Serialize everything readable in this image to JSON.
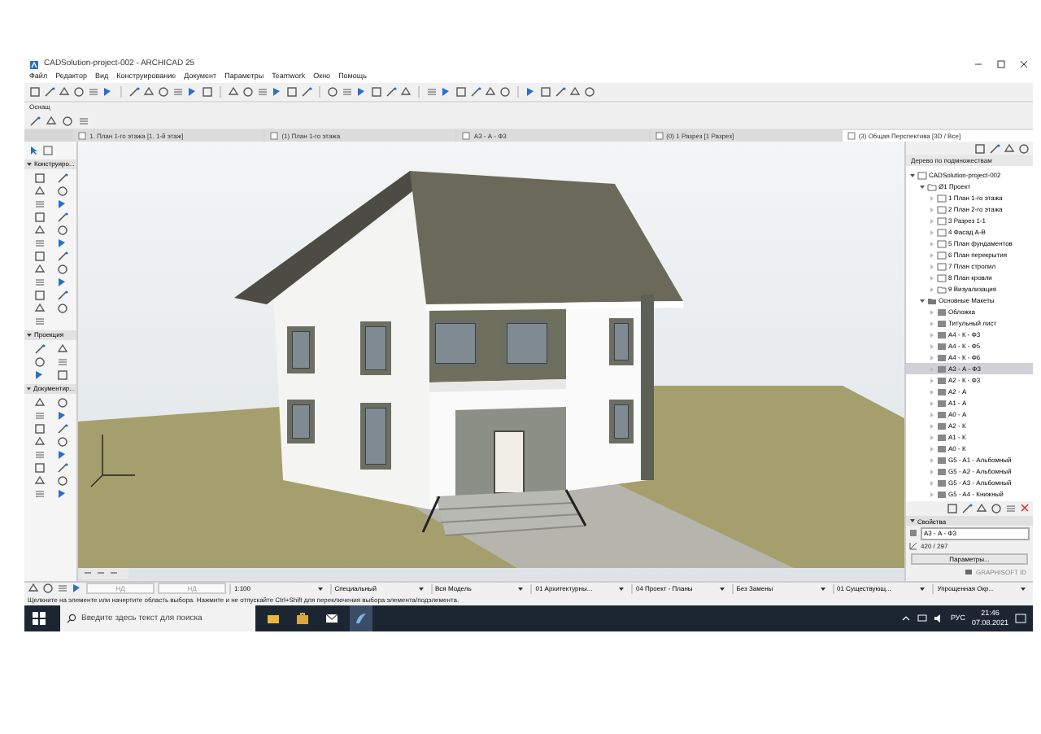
{
  "window": {
    "title": "CADSolution-project-002 - ARCHICAD 25"
  },
  "menu": [
    "Файл",
    "Редактор",
    "Вид",
    "Конструирование",
    "Документ",
    "Параметры",
    "Teamwork",
    "Окно",
    "Помощь"
  ],
  "info_box": {
    "label": "Оснащ"
  },
  "tabs": [
    {
      "label": "1. План 1-го этажа [1. 1-й этаж]",
      "selected": false
    },
    {
      "label": "(1) План 1-го этажа",
      "selected": false
    },
    {
      "label": "A3 - А - Ф3",
      "selected": false
    },
    {
      "label": "(0) 1 Разрез [1 Разрез]",
      "selected": false
    },
    {
      "label": "(3) Общая Перспектива [3D / Все]",
      "selected": true
    }
  ],
  "toolbox": {
    "sections": [
      {
        "label": "Конструиро...",
        "expanded": true
      },
      {
        "label": "Проекция",
        "expanded": true
      },
      {
        "label": "Документир...",
        "expanded": true
      }
    ]
  },
  "navigator": {
    "header": "Дерево по подмножествам",
    "tree": [
      {
        "label": "CADSolution-project-002",
        "kind": "project",
        "selected": false,
        "expanded": true,
        "children": [
          {
            "label": "Ø1 Проект",
            "kind": "folder",
            "selected": false,
            "expanded": true,
            "children": [
              {
                "label": "1 План 1-го этажа",
                "kind": "view",
                "selected": false
              },
              {
                "label": "2 План 2-го этажа",
                "kind": "view",
                "selected": false
              },
              {
                "label": "3 Разрез 1-1",
                "kind": "view",
                "selected": false
              },
              {
                "label": "4 Фасад А-В",
                "kind": "view",
                "selected": false
              },
              {
                "label": "5 План фундаментов",
                "kind": "view",
                "selected": false
              },
              {
                "label": "6 План перекрытия",
                "kind": "view",
                "selected": false
              },
              {
                "label": "7 План стропил",
                "kind": "view",
                "selected": false
              },
              {
                "label": "8 План кровли",
                "kind": "view",
                "selected": false
              },
              {
                "label": "9 Визуализация",
                "kind": "folder",
                "selected": false
              }
            ]
          },
          {
            "label": "Основные Макеты",
            "kind": "master",
            "selected": false,
            "expanded": true,
            "children": [
              {
                "label": "Обложка",
                "kind": "layout",
                "selected": false
              },
              {
                "label": "Титульный лист",
                "kind": "layout",
                "selected": false
              },
              {
                "label": "A4 - К - Ф3",
                "kind": "layout",
                "selected": false
              },
              {
                "label": "A4 - К - Ф5",
                "kind": "layout",
                "selected": false
              },
              {
                "label": "A4 - К - Ф6",
                "kind": "layout",
                "selected": false
              },
              {
                "label": "A3 - А - Ф3",
                "kind": "layout",
                "selected": true
              },
              {
                "label": "A2 - К - Ф3",
                "kind": "layout",
                "selected": false
              },
              {
                "label": "A2 - А",
                "kind": "layout",
                "selected": false
              },
              {
                "label": "A1 - А",
                "kind": "layout",
                "selected": false
              },
              {
                "label": "A0 - А",
                "kind": "layout",
                "selected": false
              },
              {
                "label": "A2 - К",
                "kind": "layout",
                "selected": false
              },
              {
                "label": "A1 - К",
                "kind": "layout",
                "selected": false
              },
              {
                "label": "A0 - К",
                "kind": "layout",
                "selected": false
              },
              {
                "label": "G5 - A1 - Альбомный",
                "kind": "layout",
                "selected": false
              },
              {
                "label": "G5 - A2 - Альбомный",
                "kind": "layout",
                "selected": false
              },
              {
                "label": "G5 - A3 - Альбомный",
                "kind": "layout",
                "selected": false
              },
              {
                "label": "G5 - A4 - Книжный",
                "kind": "layout",
                "selected": false
              }
            ]
          }
        ]
      }
    ]
  },
  "properties": {
    "title": "Свойства",
    "expanded": true,
    "name": "A3 - А - Ф3",
    "size": "420 / 297",
    "button": "Параметры...",
    "footer": "GRAPHISOFT ID"
  },
  "bottom_bar": {
    "zoom_fields": [
      "НД",
      "НД"
    ],
    "dropdowns": [
      "1:100",
      "Специальный",
      "Вся Модель",
      "01 Архитектурны...",
      "04 Проект - Планы",
      "Без Замены",
      "01 Существующ...",
      "Упрощенная Окр..."
    ]
  },
  "status_bar": "Щелкните на элементе или начертите область выбора. Нажмите и не отпускайте Ctrl+Shift для переключения выбора элемента/подэлемента.",
  "taskbar": {
    "search_placeholder": "Введите здесь текст для поиска",
    "language": "РУС",
    "time": "21:46",
    "date": "07.08.2021"
  }
}
